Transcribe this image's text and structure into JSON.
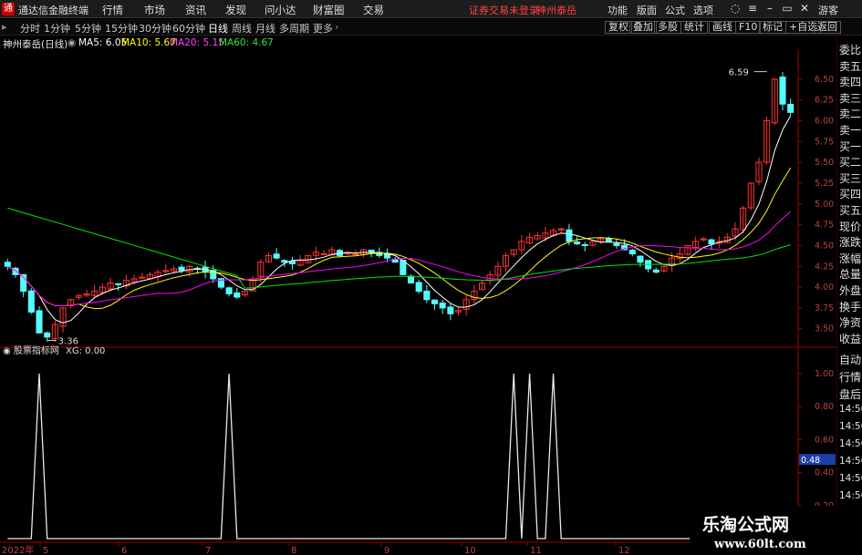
{
  "topbar": {
    "app_title": "通达信金融终端",
    "menu": [
      "行情",
      "市场",
      "资讯",
      "发现",
      "问小达",
      "财富圈",
      "交易"
    ],
    "notice": "证券交易未登录",
    "stock_link": "神州泰岳",
    "right_menu": [
      "功能",
      "版面",
      "公式",
      "选项"
    ],
    "guest": "游客"
  },
  "timeframes": [
    "分时",
    "1分钟",
    "5分钟",
    "15分钟",
    "30分钟",
    "60分钟",
    "日线",
    "周线",
    "月线",
    "多周期",
    "更多"
  ],
  "active_timeframe": "日线",
  "right_tools": [
    "复权",
    "叠加",
    "多股",
    "统计",
    "画线",
    "F10",
    "标记",
    "+自选",
    "返回"
  ],
  "chart_info": {
    "stock": "神州泰岳(日线)",
    "ma5": "MA5: 6.05",
    "ma10": "MA10: 5.67",
    "ma20": "MA20: 5.15",
    "ma60": "MA60: 4.67",
    "high_label": "6.59",
    "low_label": "3.36",
    "sub_title": "股票指标网",
    "sub_value": "XG: 0.00",
    "sub_current": "0.48",
    "year": "2022年"
  },
  "sidebar": {
    "top_labels": [
      "委比",
      "卖五",
      "卖四",
      "卖三",
      "卖二",
      "卖一",
      "买一",
      "买二",
      "买三",
      "买四",
      "买五",
      "现价",
      "涨跌",
      "涨幅",
      "总量",
      "外盘",
      "换手",
      "净资",
      "收益"
    ],
    "bottom_labels": [
      "自动",
      "行情",
      "盘后",
      "14:56",
      "14:56",
      "14:56",
      "14:56",
      "14:56",
      "14:56",
      "14:56",
      "14:56",
      "14:56"
    ]
  },
  "watermark": {
    "title": "乐淘公式网",
    "url": "www.60lt.com"
  },
  "colors": {
    "up": "#ff3232",
    "down": "#54fcfc",
    "ma5": "#ffffff",
    "ma10": "#ffff00",
    "ma20": "#ff00ff",
    "ma60": "#00e600",
    "axis": "#a00000"
  },
  "chart_data": [
    {
      "type": "candlestick",
      "title": "神州泰岳(日线)",
      "y_ticks": [
        3.5,
        3.75,
        4.0,
        4.25,
        4.5,
        4.75,
        5.0,
        5.25,
        5.5,
        5.75,
        6.0,
        6.25,
        6.5
      ],
      "ylim": [
        3.3,
        6.75
      ],
      "x_ticks": [
        "5",
        "6",
        "7",
        "8",
        "9",
        "10",
        "11",
        "12"
      ],
      "series": [
        {
          "name": "MA5",
          "value": 6.05
        },
        {
          "name": "MA10",
          "value": 5.67
        },
        {
          "name": "MA20",
          "value": 5.15
        },
        {
          "name": "MA60",
          "value": 4.67
        }
      ],
      "close": [
        4.25,
        4.15,
        3.95,
        3.7,
        3.45,
        3.4,
        3.55,
        3.75,
        3.85,
        3.9,
        3.92,
        3.95,
        4.0,
        4.05,
        4.03,
        4.08,
        4.1,
        4.12,
        4.15,
        4.18,
        4.2,
        4.22,
        4.2,
        4.25,
        4.22,
        4.18,
        4.1,
        4.0,
        3.92,
        3.88,
        3.95,
        4.1,
        4.3,
        4.38,
        4.35,
        4.3,
        4.28,
        4.32,
        4.38,
        4.42,
        4.4,
        4.45,
        4.38,
        4.42,
        4.4,
        4.45,
        4.42,
        4.38,
        4.35,
        4.3,
        4.15,
        4.05,
        3.95,
        3.85,
        3.8,
        3.75,
        3.68,
        3.72,
        3.85,
        3.95,
        4.05,
        4.15,
        4.25,
        4.38,
        4.45,
        4.55,
        4.6,
        4.62,
        4.65,
        4.68,
        4.7,
        4.55,
        4.52,
        4.5,
        4.55,
        4.58,
        4.55,
        4.5,
        4.45,
        4.4,
        4.3,
        4.22,
        4.18,
        4.25,
        4.35,
        4.4,
        4.5,
        4.55,
        4.58,
        4.52,
        4.55,
        4.6,
        4.7,
        4.95,
        5.25,
        5.5,
        6.0,
        6.5,
        6.2,
        6.1
      ],
      "low_point": 3.36,
      "high_point": 6.59
    },
    {
      "type": "line",
      "title": "股票指标网",
      "series_name": "XG",
      "value": 0.0,
      "y_ticks": [
        0.0,
        0.2,
        0.4,
        0.6,
        0.8,
        1.0
      ],
      "ylim": [
        0,
        1.05
      ],
      "x": [
        0,
        1,
        2,
        3,
        4,
        5,
        6,
        7,
        8,
        9,
        10,
        11,
        12,
        13,
        14,
        15,
        16,
        17,
        18,
        19,
        20,
        21,
        22,
        23,
        24,
        25,
        26,
        27,
        28,
        29,
        30,
        31,
        32,
        33,
        34,
        35,
        36,
        37,
        38,
        39,
        40,
        41,
        42,
        43,
        44,
        45,
        46,
        47,
        48,
        49,
        50,
        51,
        52,
        53,
        54,
        55,
        56,
        57,
        58,
        59,
        60,
        61,
        62,
        63,
        64,
        65,
        66,
        67,
        68,
        69,
        70,
        71,
        72,
        73,
        74,
        75,
        76,
        77,
        78,
        79,
        80,
        81,
        82,
        83,
        84,
        85,
        86,
        87,
        88,
        89,
        90,
        91,
        92,
        93,
        94,
        95,
        96,
        97,
        98,
        99
      ],
      "values": [
        0,
        0,
        0,
        0,
        1,
        0,
        0,
        0,
        0,
        0,
        0,
        0,
        0,
        0,
        0,
        0,
        0,
        0,
        0,
        0,
        0,
        0,
        0,
        0,
        0,
        0,
        0,
        0,
        1,
        0,
        0,
        0,
        0,
        0,
        0,
        0,
        0,
        0,
        0,
        0,
        0,
        0,
        0,
        0,
        0,
        0,
        0,
        0,
        0,
        0,
        0,
        0,
        0,
        0,
        0,
        0,
        0,
        0,
        0,
        0,
        0,
        0,
        0,
        0,
        1,
        0,
        1,
        0,
        0,
        1,
        0,
        0,
        0,
        0,
        0,
        0,
        0,
        0,
        0,
        0,
        0,
        0,
        0,
        0,
        0,
        0,
        0,
        0,
        0,
        0,
        0,
        0,
        0,
        0,
        0,
        0,
        0,
        0,
        0,
        0
      ],
      "current": 0.48
    }
  ]
}
